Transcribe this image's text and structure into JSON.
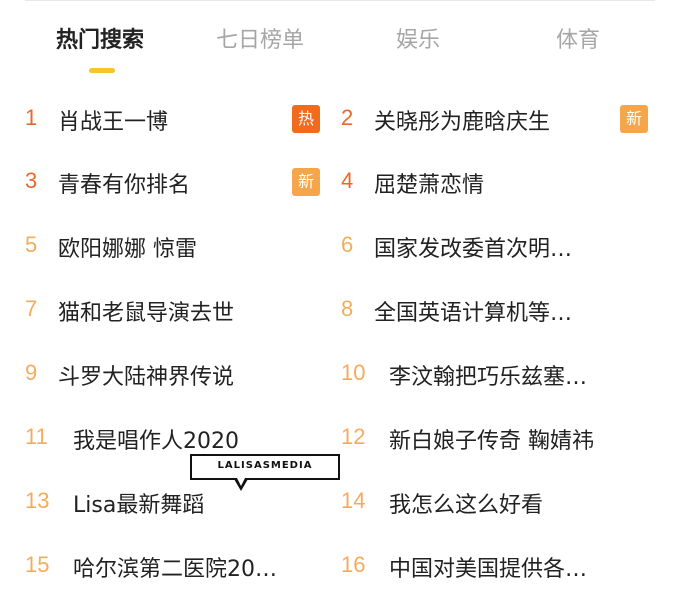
{
  "tabs": [
    {
      "label": "热门搜索",
      "active": true
    },
    {
      "label": "七日榜单",
      "active": false
    },
    {
      "label": "娱乐",
      "active": false
    },
    {
      "label": "体育",
      "active": false
    }
  ],
  "colors": {
    "rank_top": "#e8692a",
    "rank_rest": "#f3ac5c",
    "badge_hot": "#f06b1e",
    "badge_new": "#f5a64a",
    "tab_indicator": "#f7c52d"
  },
  "items": [
    {
      "rank": "1",
      "title": "肖战王一博",
      "badge": "热"
    },
    {
      "rank": "2",
      "title": "关晓彤为鹿晗庆生",
      "badge": "新"
    },
    {
      "rank": "3",
      "title": "青春有你排名",
      "badge": "新"
    },
    {
      "rank": "4",
      "title": "屈楚萧恋情",
      "badge": ""
    },
    {
      "rank": "5",
      "title": "欧阳娜娜 惊雷",
      "badge": ""
    },
    {
      "rank": "6",
      "title": "国家发改委首次明…",
      "badge": ""
    },
    {
      "rank": "7",
      "title": "猫和老鼠导演去世",
      "badge": ""
    },
    {
      "rank": "8",
      "title": "全国英语计算机等…",
      "badge": ""
    },
    {
      "rank": "9",
      "title": "斗罗大陆神界传说",
      "badge": ""
    },
    {
      "rank": "10",
      "title": "李汶翰把巧乐兹塞…",
      "badge": ""
    },
    {
      "rank": "11",
      "title": "我是唱作人2020",
      "badge": ""
    },
    {
      "rank": "12",
      "title": "新白娘子传奇 鞠婧祎",
      "badge": ""
    },
    {
      "rank": "13",
      "title": "Lisa最新舞蹈",
      "badge": ""
    },
    {
      "rank": "14",
      "title": "我怎么这么好看",
      "badge": ""
    },
    {
      "rank": "15",
      "title": "哈尔滨第二医院20…",
      "badge": ""
    },
    {
      "rank": "16",
      "title": "中国对美国提供各…",
      "badge": ""
    }
  ],
  "watermark": {
    "text": "LALISASMEDIA"
  }
}
